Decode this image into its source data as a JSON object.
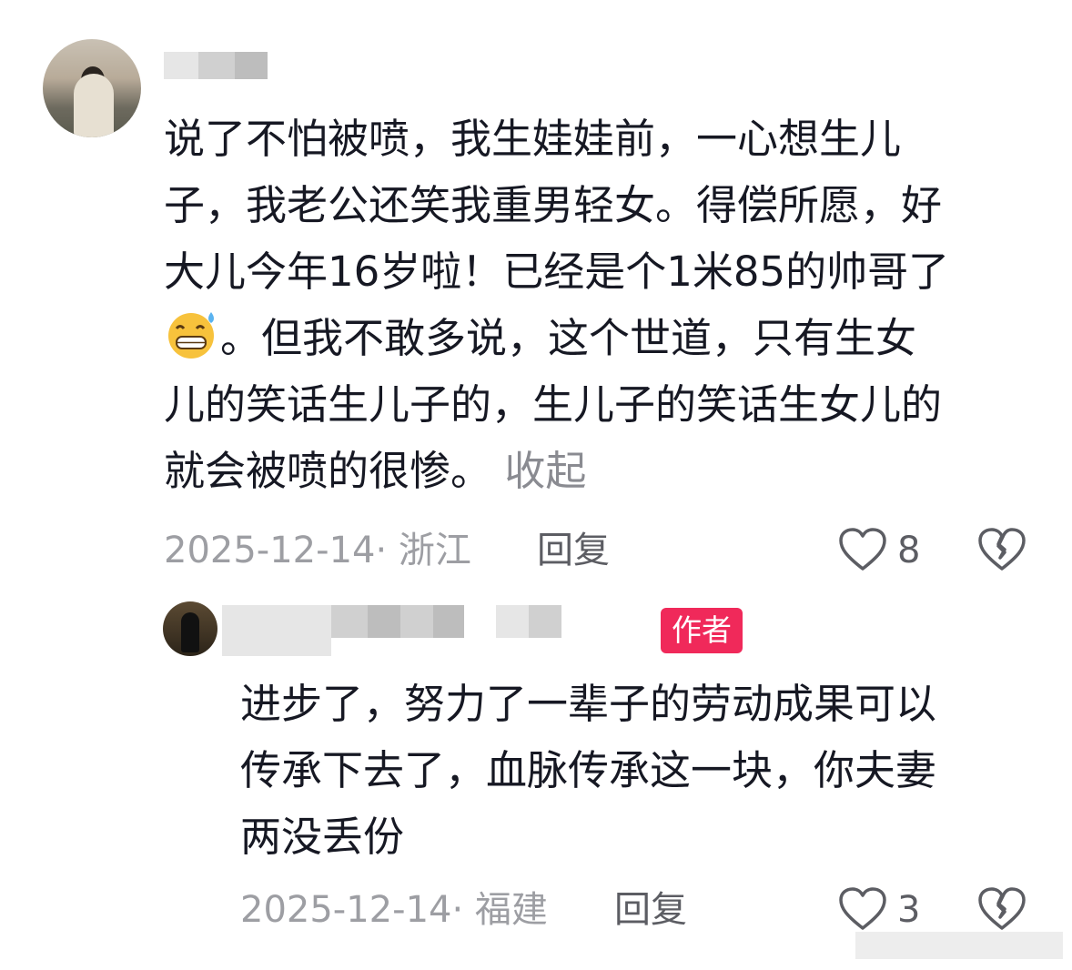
{
  "comment": {
    "lines": [
      "说了不怕被喷，我生娃娃前，一心想生儿",
      "子，我老公还笑我重男轻女。得偿所愿，好",
      "大儿今年16岁啦！已经是个1米85的帅哥了",
      "。但我不敢多说，这个世道，只有生女",
      "儿的笑话生儿子的，生儿子的笑话生女儿的",
      "就会被喷的很惨。"
    ],
    "emoji": "grinning-sweat-emoji",
    "collapse_label": "收起",
    "date_location": "2025-12-14· 浙江",
    "reply_label": "回复",
    "like_count": "8"
  },
  "reply": {
    "author_badge": "作者",
    "lines": [
      "进步了，努力了一辈子的劳动成果可以",
      "传承下去了，血脉传承这一块，你夫妻",
      "两没丢份"
    ],
    "date_location": "2025-12-14· 福建",
    "reply_label": "回复",
    "like_count": "3"
  },
  "colors": {
    "badge": "#f0295a",
    "text": "#161823",
    "meta": "#9d9ea3"
  },
  "icons": [
    "heart-outline-icon",
    "broken-heart-outline-icon"
  ]
}
